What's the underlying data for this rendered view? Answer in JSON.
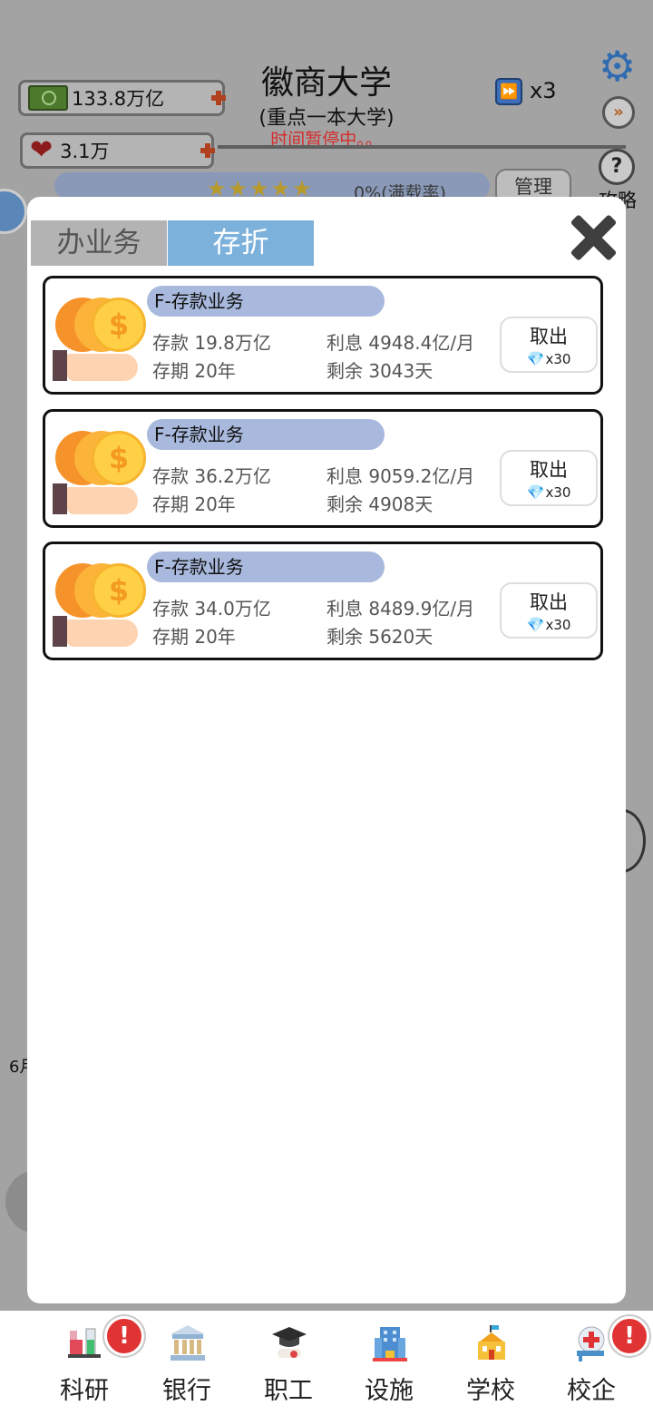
{
  "header": {
    "title": "徽商大学",
    "subtitle": "(重点一本大学)",
    "status": "时间暂停中。。",
    "speed_label": "x3",
    "help_label": "攻略",
    "manage_label": "管理",
    "stars_pct": "0%(满载率)"
  },
  "resources": {
    "money": "133.8万亿",
    "reputation": "3.1万"
  },
  "modal": {
    "tabs": [
      {
        "label": "办业务",
        "active": false
      },
      {
        "label": "存折",
        "active": true
      }
    ],
    "cards": [
      {
        "title": "F-存款业务",
        "deposit": "存款 19.8万亿",
        "interest": "利息 4948.4亿/月",
        "term": "存期 20年",
        "remaining": "剩余 3043天",
        "button": "取出",
        "cost": "x30"
      },
      {
        "title": "F-存款业务",
        "deposit": "存款 36.2万亿",
        "interest": "利息 9059.2亿/月",
        "term": "存期 20年",
        "remaining": "剩余 4908天",
        "button": "取出",
        "cost": "x30"
      },
      {
        "title": "F-存款业务",
        "deposit": "存款 34.0万亿",
        "interest": "利息 8489.9亿/月",
        "term": "存期 20年",
        "remaining": "剩余 5620天",
        "button": "取出",
        "cost": "x30"
      }
    ]
  },
  "background_partial": {
    "left_label": "6月"
  },
  "nav": {
    "items": [
      {
        "label": "科研",
        "icon": "flask-icon",
        "badge": "!"
      },
      {
        "label": "银行",
        "icon": "bank-icon",
        "badge": ""
      },
      {
        "label": "职工",
        "icon": "graduation-cap-icon",
        "badge": ""
      },
      {
        "label": "设施",
        "icon": "building-icon",
        "badge": ""
      },
      {
        "label": "学校",
        "icon": "school-icon",
        "badge": ""
      },
      {
        "label": "校企",
        "icon": "medical-icon",
        "badge": "!"
      }
    ]
  },
  "colors": {
    "tab_active": "#7cb1dc",
    "tab_inactive": "#b3b3b3",
    "tag_bg": "#a8b9dd",
    "status_red": "#d62a2a",
    "badge_red": "#e03434"
  }
}
